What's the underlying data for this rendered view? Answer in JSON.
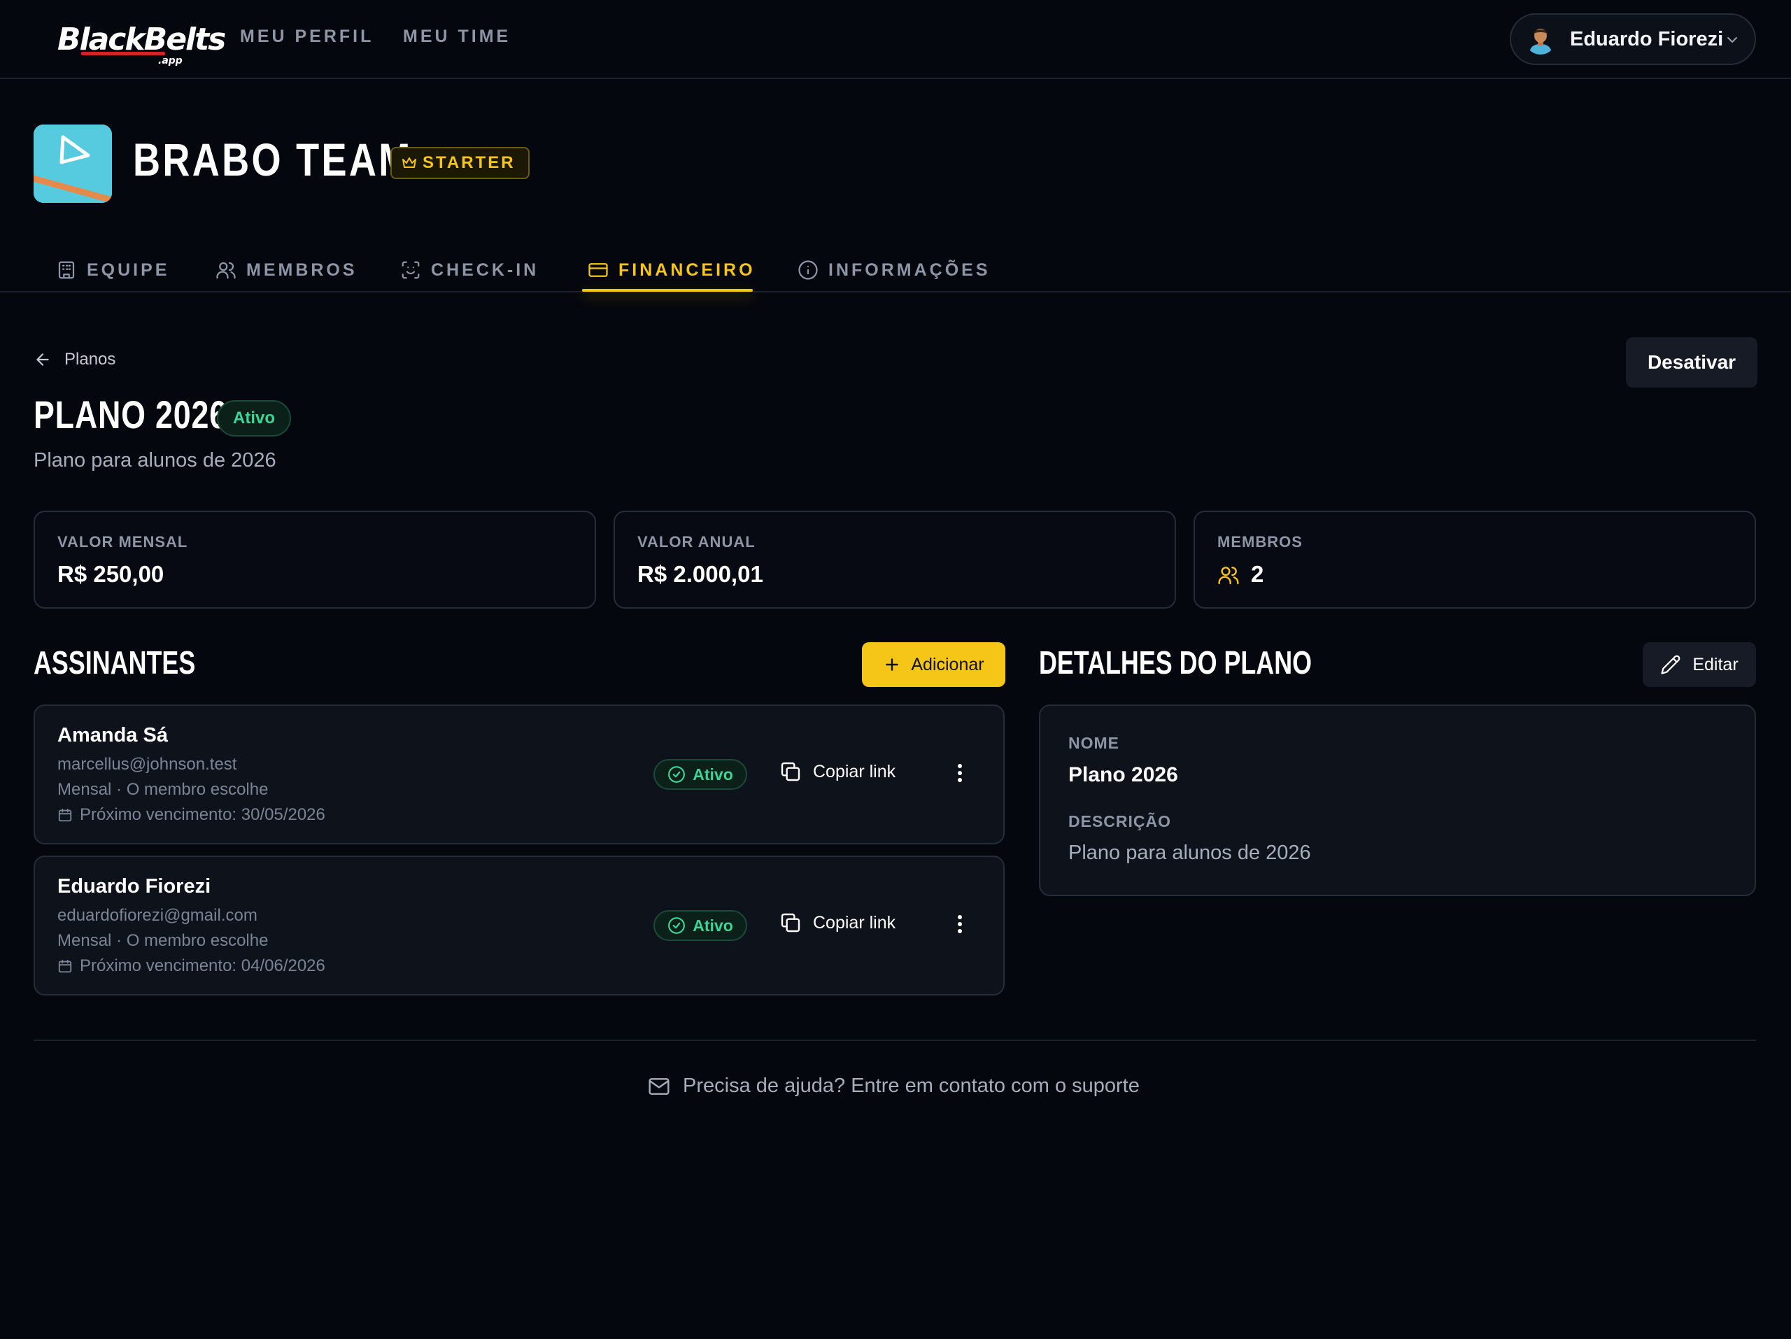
{
  "app": {
    "logo_text": "BlackBelts",
    "logo_sub": ".app"
  },
  "topnav": {
    "links": [
      "MEU PERFIL",
      "MEU TIME"
    ],
    "user_name": "Eduardo Fiorezi"
  },
  "team": {
    "name": "BRABO TEAM",
    "plan_badge": "STARTER"
  },
  "tabs": [
    {
      "label": "EQUIPE",
      "icon": "building-icon",
      "active": false
    },
    {
      "label": "MEMBROS",
      "icon": "users-icon",
      "active": false
    },
    {
      "label": "CHECK-IN",
      "icon": "scan-face-icon",
      "active": false
    },
    {
      "label": "FINANCEIRO",
      "icon": "credit-card-icon",
      "active": true
    },
    {
      "label": "INFORMAÇÕES",
      "icon": "info-icon",
      "active": false
    }
  ],
  "page": {
    "back_label": "Planos",
    "deactivate_label": "Desativar",
    "title": "PLANO 2026",
    "status": "Ativo",
    "subtitle": "Plano para alunos de 2026"
  },
  "stats": [
    {
      "label": "VALOR MENSAL",
      "value": "R$ 250,00"
    },
    {
      "label": "VALOR ANUAL",
      "value": "R$ 2.000,01"
    },
    {
      "label": "MEMBROS",
      "value": "2",
      "icon": "users-icon"
    }
  ],
  "subscribers": {
    "title": "ASSINANTES",
    "add_label": "Adicionar",
    "items": [
      {
        "name": "Amanda Sá",
        "email": "marcellus@johnson.test",
        "plan": "Mensal · O membro escolhe",
        "due": "Próximo vencimento: 30/05/2026",
        "status": "Ativo",
        "copy_label": "Copiar link"
      },
      {
        "name": "Eduardo Fiorezi",
        "email": "eduardofiorezi@gmail.com",
        "plan": "Mensal · O membro escolhe",
        "due": "Próximo vencimento: 04/06/2026",
        "status": "Ativo",
        "copy_label": "Copiar link"
      }
    ]
  },
  "details": {
    "title": "DETALHES DO PLANO",
    "edit_label": "Editar",
    "name_label": "NOME",
    "name_value": "Plano 2026",
    "desc_label": "DESCRIÇÃO",
    "desc_value": "Plano para alunos de 2026"
  },
  "footer": {
    "support_text": "Precisa de ajuda? Entre em contato com o suporte"
  },
  "colors": {
    "accent": "#f5c518",
    "success": "#3fd497",
    "background": "#05070e",
    "card": "#0e121b"
  }
}
